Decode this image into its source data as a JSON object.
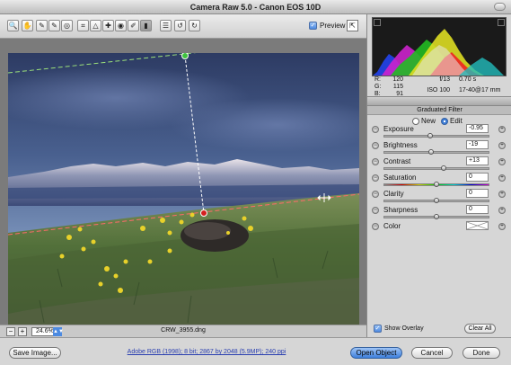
{
  "window": {
    "title": "Camera Raw 5.0  -  Canon EOS 10D"
  },
  "toolbar": {
    "tools": [
      {
        "name": "zoom-tool",
        "icon": "magnifier-icon",
        "glyph": "🔍"
      },
      {
        "name": "hand-tool",
        "icon": "hand-icon",
        "glyph": "✋"
      },
      {
        "name": "white-balance-tool",
        "icon": "eyedropper-icon",
        "glyph": "✎"
      },
      {
        "name": "color-sampler-tool",
        "icon": "color-sampler-icon",
        "glyph": "✎"
      },
      {
        "name": "targeted-adjustment-tool",
        "icon": "target-icon",
        "glyph": "◎"
      },
      {
        "name": "crop-tool",
        "icon": "crop-icon",
        "glyph": "⌗"
      },
      {
        "name": "straighten-tool",
        "icon": "straighten-icon",
        "glyph": "△"
      },
      {
        "name": "spot-removal-tool",
        "icon": "spot-removal-icon",
        "glyph": "✚"
      },
      {
        "name": "red-eye-tool",
        "icon": "red-eye-icon",
        "glyph": "◉"
      },
      {
        "name": "adjustment-brush-tool",
        "icon": "brush-icon",
        "glyph": "✐"
      },
      {
        "name": "graduated-filter-tool",
        "icon": "graduated-filter-icon",
        "glyph": "▮"
      },
      {
        "name": "preferences-tool",
        "icon": "list-icon",
        "glyph": "☰"
      },
      {
        "name": "rotate-ccw-tool",
        "icon": "rotate-left-icon",
        "glyph": "↺"
      },
      {
        "name": "rotate-cw-tool",
        "icon": "rotate-right-icon",
        "glyph": "↻"
      }
    ],
    "active_tool": "graduated-filter-tool",
    "preview_label": "Preview",
    "preview_checked": true
  },
  "status": {
    "zoom": "24.6%",
    "filename": "CRW_3955.dng"
  },
  "readout": {
    "r_label": "R:",
    "r_value": "120",
    "g_label": "G:",
    "g_value": "115",
    "b_label": "B:",
    "b_value": "91",
    "aperture": "f/13",
    "shutter": "0.70 s",
    "iso": "ISO 100",
    "lens": "17-40@17 mm"
  },
  "panel": {
    "title": "Graduated Filter",
    "mode_new": "New",
    "mode_edit": "Edit",
    "mode_selected": "edit",
    "sliders": [
      {
        "name": "exposure",
        "label": "Exposure",
        "value": "-0.95",
        "position": 0.44,
        "style": "plain"
      },
      {
        "name": "brightness",
        "label": "Brightness",
        "value": "-19",
        "position": 0.45,
        "style": "plain"
      },
      {
        "name": "contrast",
        "label": "Contrast",
        "value": "+13",
        "position": 0.57,
        "style": "plain"
      },
      {
        "name": "saturation",
        "label": "Saturation",
        "value": "0",
        "position": 0.5,
        "style": "sat"
      },
      {
        "name": "clarity",
        "label": "Clarity",
        "value": "0",
        "position": 0.5,
        "style": "plain"
      },
      {
        "name": "sharpness",
        "label": "Sharpness",
        "value": "0",
        "position": 0.5,
        "style": "plain"
      }
    ],
    "color_label": "Color",
    "show_overlay_label": "Show Overlay",
    "show_overlay_checked": true,
    "clear_all_label": "Clear All"
  },
  "bottom": {
    "save_label": "Save Image...",
    "workflow_info": "Adobe RGB (1998); 8 bit; 2867 by 2048 (5.9MP); 240 ppi",
    "open_label": "Open Object",
    "cancel_label": "Cancel",
    "done_label": "Done"
  },
  "colors": {
    "accent": "#3d7fdc",
    "filter_start_pin": "#3ec23e",
    "filter_end_pin": "#d42020",
    "start_line": "#9be07a",
    "end_line": "#ff6a6a"
  }
}
